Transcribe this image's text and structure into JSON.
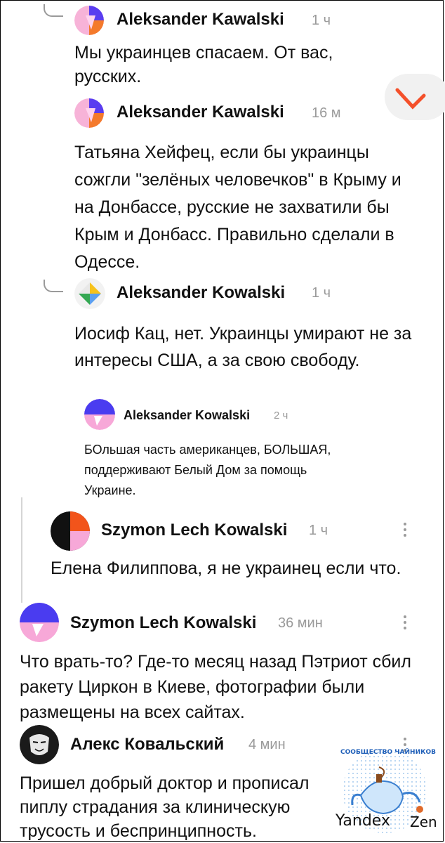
{
  "comments": [
    {
      "name": "Aleksander Kawalski",
      "time": "1 ч",
      "text": "Мы украинцев спасаем. От вас, русских."
    },
    {
      "name": "Aleksander Kawalski",
      "time": "16 м",
      "text": "Татьяна Хейфец, если бы украинцы сожгли \"зелёных человечков\" в Крыму и на Донбассе, русские не захватили бы Крым и Донбасс. Правильно сделали в Одессе."
    },
    {
      "name": "Aleksander Kowalski",
      "time": "1 ч",
      "text": "Иосиф Кац, нет. Украинцы умирают не за интересы США, а за свою свободу."
    },
    {
      "name": "Aleksander Kowalski",
      "time": "2 ч",
      "text": "БОльшая часть американцев, БОЛЬШАЯ, поддерживают Белый Дом за помощь Украине."
    },
    {
      "name": "Szymon Lech Kowalski",
      "time": "1 ч",
      "text": "Елена Филиппова, я не украинец если что."
    },
    {
      "name": "Szymon Lech Kowalski",
      "time": "36 мин",
      "text": "Что врать-то? Где-то месяц назад Пэтриот сбил ракету Циркон в Киеве, фотографии были размещены на всех сайтах."
    },
    {
      "name": "Алекс Ковальский",
      "time": "4 мин",
      "text": "Пришел добрый доктор и прописал пиплу страдания за клиническую трусость и беспринципность."
    }
  ],
  "watermark": {
    "community": "СООБЩЕСТВО ЧАЙНИКОВ",
    "brand_left": "Yandex",
    "brand_right": "Zen"
  },
  "colors": {
    "text": "#111111",
    "meta": "#9a9a9a",
    "accent_orange": "#f26b2a",
    "accent_purple": "#4a3cf0",
    "accent_pink": "#f7a8d8"
  }
}
